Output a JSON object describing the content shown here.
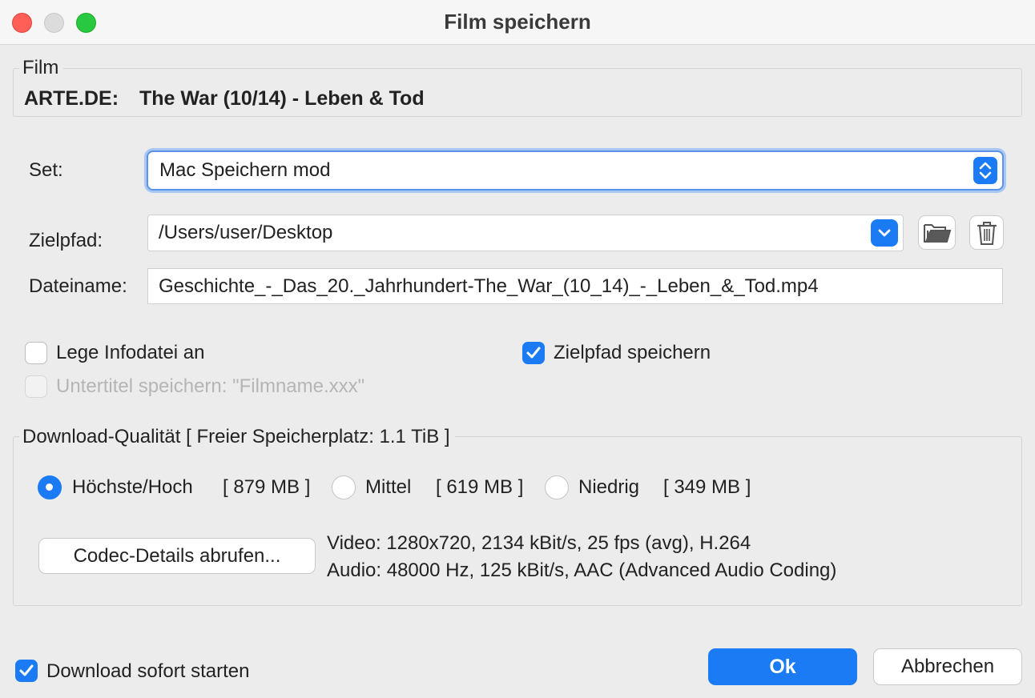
{
  "window": {
    "title": "Film speichern",
    "controls": [
      "close",
      "minimize",
      "zoom"
    ]
  },
  "film": {
    "legend": "Film",
    "sender": "ARTE.DE:",
    "title": "The War (10/14) - Leben & Tod"
  },
  "set": {
    "label": "Set:",
    "value": "Mac Speichern mod"
  },
  "zielpfad": {
    "label": "Zielpfad:",
    "value": "/Users/user/Desktop",
    "folder_icon": "folder-icon",
    "trash_icon": "trash-icon"
  },
  "dateiname": {
    "label": "Dateiname:",
    "value": "Geschichte_-_Das_20._Jahrhundert-The_War_(10_14)_-_Leben_&_Tod.mp4"
  },
  "options": {
    "infodatei": {
      "label": "Lege Infodatei an",
      "checked": false
    },
    "zielpfad_speichern": {
      "label": "Zielpfad speichern",
      "checked": true
    },
    "untertitel": {
      "label": "Untertitel speichern: \"Filmname.xxx\"",
      "checked": false,
      "enabled": false
    }
  },
  "quality": {
    "legend": "Download-Qualität [ Freier Speicherplatz: 1.1 TiB ]",
    "options": [
      {
        "label": "Höchste/Hoch",
        "size": "[ 879 MB ]",
        "selected": true
      },
      {
        "label": "Mittel",
        "size": "[ 619 MB ]",
        "selected": false
      },
      {
        "label": "Niedrig",
        "size": "[ 349 MB ]",
        "selected": false
      }
    ],
    "codec_button": "Codec-Details abrufen...",
    "video_info": "Video: 1280x720, 2134 kBit/s, 25 fps (avg), H.264",
    "audio_info": "Audio: 48000 Hz, 125 kBit/s, AAC (Advanced Audio Coding)"
  },
  "footer": {
    "start_download": {
      "label": "Download sofort starten",
      "checked": true
    },
    "ok": "Ok",
    "cancel": "Abbrechen"
  },
  "colors": {
    "accent": "#1a7bf5",
    "close": "#ff5f57",
    "zoom": "#28c840",
    "background": "#ececec"
  }
}
